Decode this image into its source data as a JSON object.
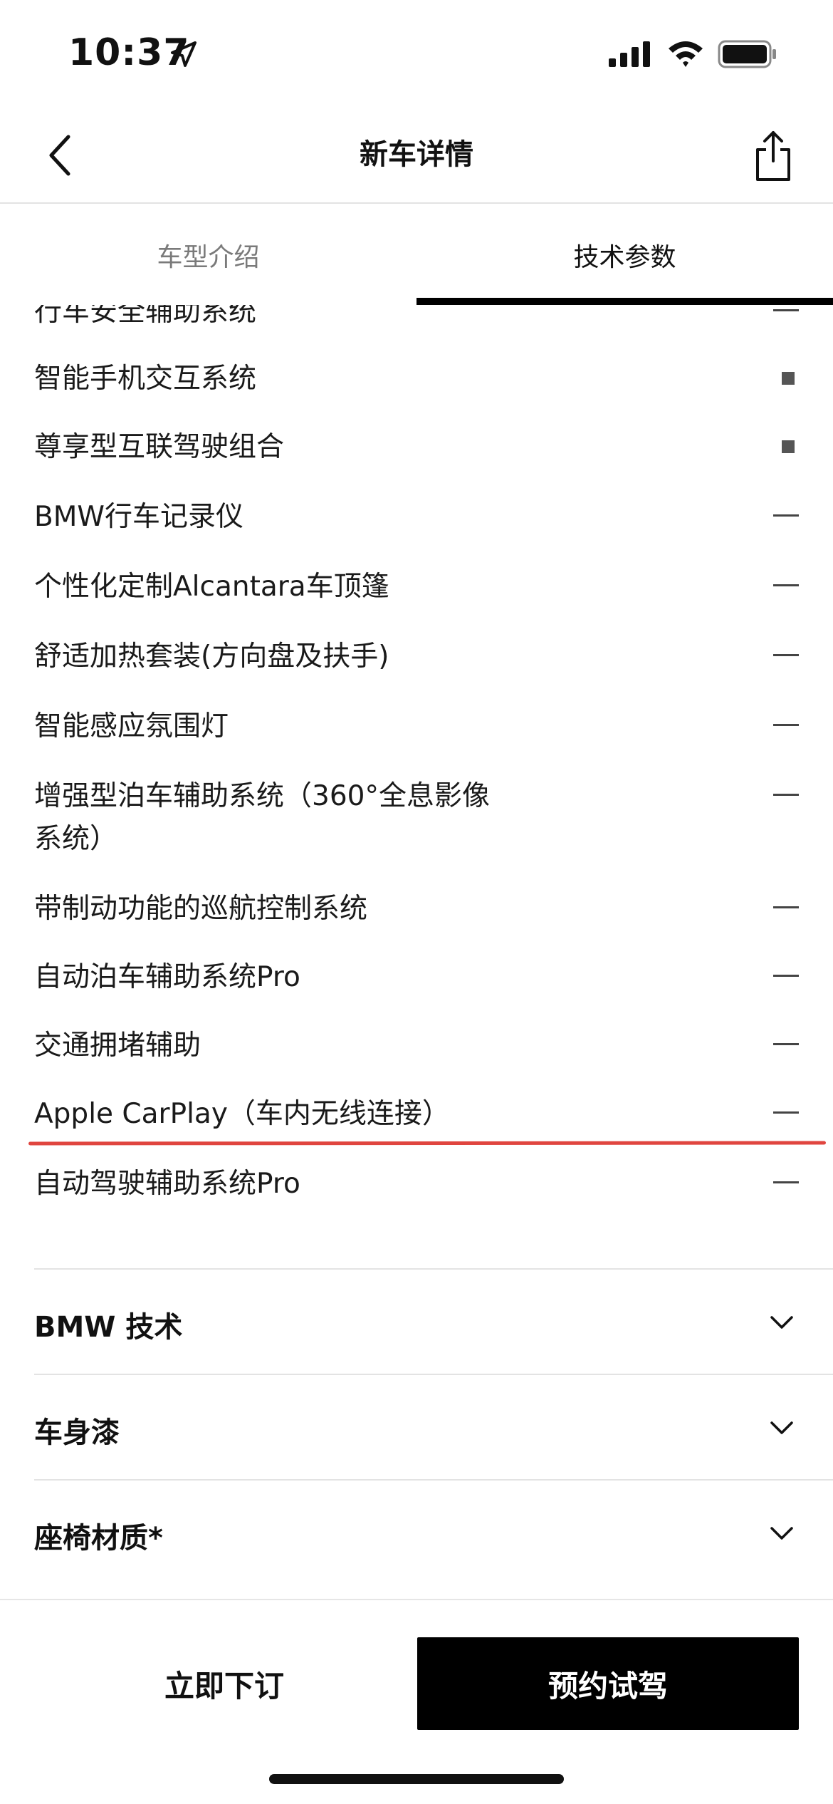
{
  "status_bar": {
    "time": "10:37"
  },
  "nav": {
    "title": "新车详情",
    "back_icon": "chevron-left-icon",
    "share_icon": "share-icon"
  },
  "tabs": [
    {
      "label": "车型介绍",
      "active": false
    },
    {
      "label": "技术参数",
      "active": true
    }
  ],
  "specs": [
    {
      "name": "行车安全辅助系统",
      "mark": "—"
    },
    {
      "name": "智能手机交互系统",
      "mark": "■"
    },
    {
      "name": "尊享型互联驾驶组合",
      "mark": "■"
    },
    {
      "name": "BMW行车记录仪",
      "mark": "—"
    },
    {
      "name": "个性化定制Alcantara车顶篷",
      "mark": "—"
    },
    {
      "name": "舒适加热套装(方向盘及扶手)",
      "mark": "—"
    },
    {
      "name": "智能感应氛围灯",
      "mark": "—"
    },
    {
      "name": "增强型泊车辅助系统（360°全息影像系统）",
      "mark": "—"
    },
    {
      "name": "带制动功能的巡航控制系统",
      "mark": "—"
    },
    {
      "name": "自动泊车辅助系统Pro",
      "mark": "—"
    },
    {
      "name": "交通拥堵辅助",
      "mark": "—"
    },
    {
      "name": "Apple CarPlay（车内无线连接）",
      "mark": "—"
    },
    {
      "name": "自动驾驶辅助系统Pro",
      "mark": "—"
    }
  ],
  "sections": [
    {
      "title": "BMW 技术"
    },
    {
      "title": "车身漆"
    },
    {
      "title": "座椅材质*"
    }
  ],
  "bottom": {
    "order_label": "立即下订",
    "test_drive_label": "预约试驾"
  },
  "colors": {
    "accent_black": "#000000",
    "annotation_red": "#e0453f"
  }
}
